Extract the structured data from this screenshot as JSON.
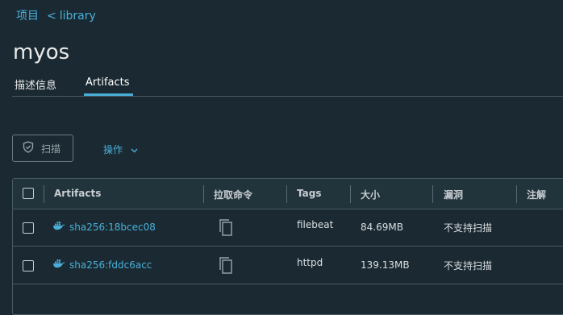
{
  "breadcrumb": {
    "root": "项目",
    "separator": "<",
    "current": "library"
  },
  "page_title": "myos",
  "tabs": [
    {
      "label": "描述信息"
    },
    {
      "label": "Artifacts"
    }
  ],
  "toolbar": {
    "scan_label": "扫描",
    "actions_label": "操作"
  },
  "table": {
    "headers": [
      "Artifacts",
      "拉取命令",
      "Tags",
      "大小",
      "漏洞",
      "注解"
    ],
    "rows": [
      {
        "artifact": "sha256:18bcec08",
        "tags": "filebeat",
        "size": "84.69MB",
        "vulnerabilities": "不支持扫描"
      },
      {
        "artifact": "sha256:fddc6acc",
        "tags": "httpd",
        "size": "139.13MB",
        "vulnerabilities": "不支持扫描"
      }
    ]
  },
  "colors": {
    "accent": "#49afd9",
    "background": "#1b2a32",
    "border": "#495a67"
  },
  "icons": {
    "scan": "shield-icon",
    "actions": "chevron-down-icon",
    "artifact": "docker-icon",
    "pull": "copy-icon"
  }
}
